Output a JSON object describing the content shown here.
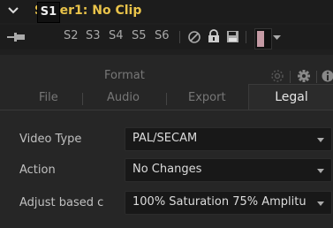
{
  "header": {
    "title": "Saver1: No Clip"
  },
  "versions": [
    "S1",
    "S2",
    "S3",
    "S4",
    "S5",
    "S6"
  ],
  "tabs_top": {
    "format": "Format"
  },
  "tabs": [
    "File",
    "Audio",
    "Export",
    "Legal"
  ],
  "legal": {
    "video_type": {
      "label": "Video Type",
      "value": "PAL/SECAM"
    },
    "action": {
      "label": "Action",
      "value": "No Changes"
    },
    "adjust": {
      "label": "Adjust based c",
      "value": "100% Saturation 75% Amplitu"
    }
  },
  "colors": {
    "title": "#e9c34a",
    "swatch": "#c49aa4"
  }
}
